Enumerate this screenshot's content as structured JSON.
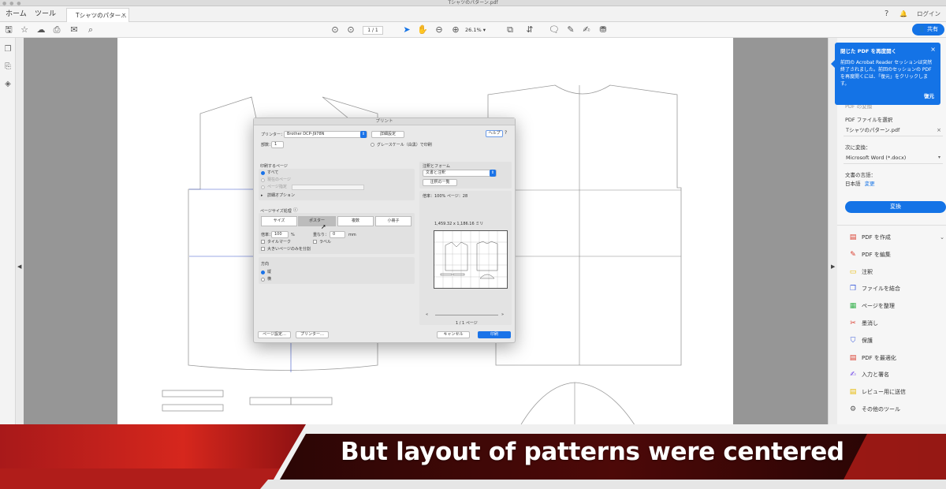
{
  "window": {
    "title": "Tシャツのパターン.pdf"
  },
  "tabs": {
    "home": "ホーム",
    "tools": "ツール",
    "document": "Tシャツのパター…",
    "close": "×"
  },
  "tabbar_right": {
    "help": "?",
    "notifications": "🔔",
    "login": "ログイン"
  },
  "toolbar": {
    "page_current": "1",
    "page_total": "1",
    "zoom": "26.1%",
    "share": "共有"
  },
  "tooltip": {
    "title": "閉じた PDF を再度開く",
    "body": "前回の Acrobat Reader セッションは突然終了されました。前回のセッションの PDF を再度開くには、「復元」をクリックします。",
    "close": "×",
    "restore": "復元"
  },
  "right_panel": {
    "partial_heading": "PDF の変換",
    "select_label": "PDF ファイルを選択",
    "selected_file": "Tシャツのパターン.pdf",
    "convert_to_label": "次に変換：",
    "format": "Microsoft Word (*.docx)",
    "language_label": "文書の言語：",
    "language_value": "日本語",
    "change_link": "変更",
    "convert_button": "変換",
    "tools": [
      {
        "icon": "create-pdf-icon",
        "glyph": "▤",
        "label": "PDF を作成",
        "color": "#d93a2b"
      },
      {
        "icon": "edit-pdf-icon",
        "glyph": "✎",
        "label": "PDF を編集",
        "color": "#d93a2b"
      },
      {
        "icon": "comment-icon",
        "glyph": "▭",
        "label": "注釈",
        "color": "#e6b800"
      },
      {
        "icon": "combine-files-icon",
        "glyph": "❐",
        "label": "ファイルを結合",
        "color": "#3b5bdb"
      },
      {
        "icon": "organize-pages-icon",
        "glyph": "▦",
        "label": "ページを整理",
        "color": "#37b24d"
      },
      {
        "icon": "redact-icon",
        "glyph": "✂",
        "label": "墨消し",
        "color": "#d93a2b"
      },
      {
        "icon": "protect-icon",
        "glyph": "⛉",
        "label": "保護",
        "color": "#3b5bdb"
      },
      {
        "icon": "optimize-pdf-icon",
        "glyph": "▤",
        "label": "PDF を最適化",
        "color": "#d93a2b"
      },
      {
        "icon": "fill-sign-icon",
        "glyph": "✍",
        "label": "入力と署名",
        "color": "#7048e8"
      },
      {
        "icon": "send-review-icon",
        "glyph": "▤",
        "label": "レビュー用に送信",
        "color": "#e6b800"
      },
      {
        "icon": "more-tools-icon",
        "glyph": "⚙",
        "label": "その他のツール",
        "color": "#555555"
      }
    ]
  },
  "print_dialog": {
    "title": "プリント",
    "printer_label": "プリンター：",
    "printer_value": "Brother DCP-J978N",
    "advanced_button": "詳細設定",
    "help_button": "ヘルプ",
    "copies_label": "部数：",
    "copies_value": "1",
    "grayscale_label": "グレースケール（白黒）で印刷",
    "pages_heading": "印刷するページ",
    "page_options": [
      "すべて",
      "現在のページ",
      "ページ指定"
    ],
    "more_options": "詳細オプション",
    "sizing_heading": "ページサイズ処理",
    "sizing_buttons": [
      "サイズ",
      "ポスター",
      "複数",
      "小冊子"
    ],
    "scale_label": "倍率：",
    "scale_value": "100",
    "scale_unit": "%",
    "overlap_label": "重なり：",
    "overlap_value": "0",
    "overlap_unit": "mm",
    "tile_marks": "タイルマーク",
    "labels": "ラベル",
    "tile_large_pages": "大きいページのみを分割",
    "orientation_heading": "方向",
    "orientation_options": [
      "縦",
      "横"
    ],
    "comments_heading": "注釈とフォーム",
    "comments_value": "文書と注釈",
    "comments_summary": "注釈の一覧",
    "scale_info": "倍率：100% ページ：28",
    "paper_size": "1,459.32 x 1,186.16 ミリ",
    "preview_nav_prev": "«",
    "preview_nav_next": "»",
    "page_indicator": "1 / 1 ページ",
    "page_setup_button": "ページ設定…",
    "printer_button": "プリンター…",
    "cancel_button": "キャンセル",
    "print_button": "印刷"
  },
  "caption": {
    "text": "But layout of patterns were centered"
  }
}
